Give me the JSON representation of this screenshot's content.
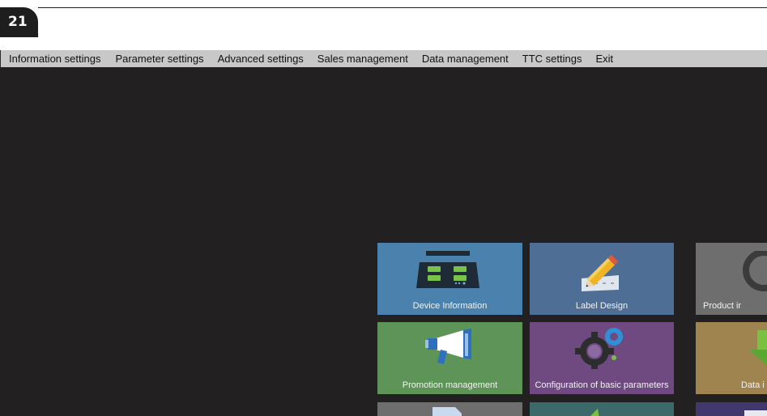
{
  "badge": {
    "number": "21"
  },
  "menu": {
    "items": [
      {
        "label": "Information settings"
      },
      {
        "label": "Parameter settings"
      },
      {
        "label": "Advanced settings"
      },
      {
        "label": "Sales management"
      },
      {
        "label": "Data management"
      },
      {
        "label": "TTC settings"
      },
      {
        "label": "Exit"
      }
    ]
  },
  "tiles": {
    "device_info": {
      "label": "Device Information",
      "color": "#4a82ad",
      "icon": "scale-icon"
    },
    "label_design": {
      "label": "Label Design",
      "color": "#4f6e96",
      "icon": "pencil-icon"
    },
    "product_info": {
      "label": "Product ir",
      "color": "#6e6e6e",
      "icon": "magnifier-icon"
    },
    "promotion": {
      "label": "Promotion management",
      "color": "#5f9459",
      "icon": "megaphone-icon"
    },
    "basic_params": {
      "label": "Configuration of basic parameters",
      "color": "#6e4a80",
      "icon": "gears-icon"
    },
    "data_import": {
      "label": "Data i",
      "color": "#a0844f",
      "icon": "download-arrow-icon"
    },
    "row3_a": {
      "color": "#6e6e6e",
      "icon": "document-icon"
    },
    "row3_b": {
      "color": "#3c6a6a",
      "icon": "green-arrow-icon"
    },
    "row3_c": {
      "color": "#41386e",
      "icon": "window-icon"
    }
  }
}
